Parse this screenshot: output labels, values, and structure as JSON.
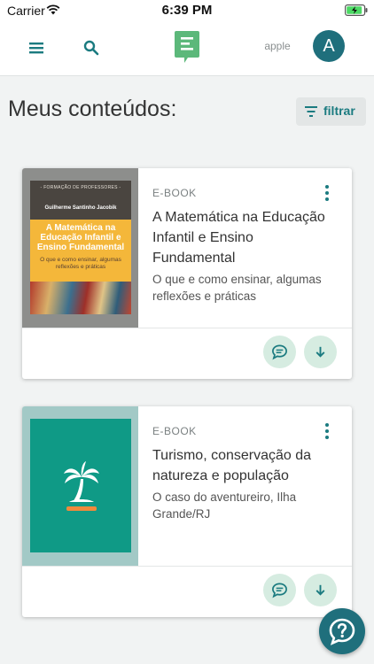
{
  "status_bar": {
    "carrier": "Carrier",
    "time": "6:39 PM"
  },
  "header": {
    "username": "apple",
    "avatar_initial": "A",
    "icons": [
      "menu-icon",
      "search-icon",
      "app-logo-icon"
    ]
  },
  "page": {
    "title": "Meus conteúdos:",
    "filter_label": "filtrar"
  },
  "items": [
    {
      "type": "E-BOOK",
      "title": "A Matemática na Educação Infantil e Ensino Fundamental",
      "subtitle": "O que e como ensinar, algumas reflexões e práticas",
      "cover": {
        "series": "- FORMAÇÃO DE PROFESSORES -",
        "author": "Guilherme Santinho Jacobik",
        "title": "A Matemática na Educação Infantil e Ensino Fundamental",
        "subtitle": "O que e como ensinar, algumas reflexões e práticas"
      }
    },
    {
      "type": "E-BOOK",
      "title": "Turismo, conservação da natureza e população",
      "subtitle": "O caso do aventureiro, Ilha Grande/RJ",
      "cover": {
        "icon": "palm-tree-icon"
      }
    }
  ],
  "colors": {
    "brand": "#1b7b80",
    "avatar": "#1f6f7c",
    "action_button": "#d6ece1",
    "logo": "#5cb87a",
    "background": "#f1f3f3"
  }
}
